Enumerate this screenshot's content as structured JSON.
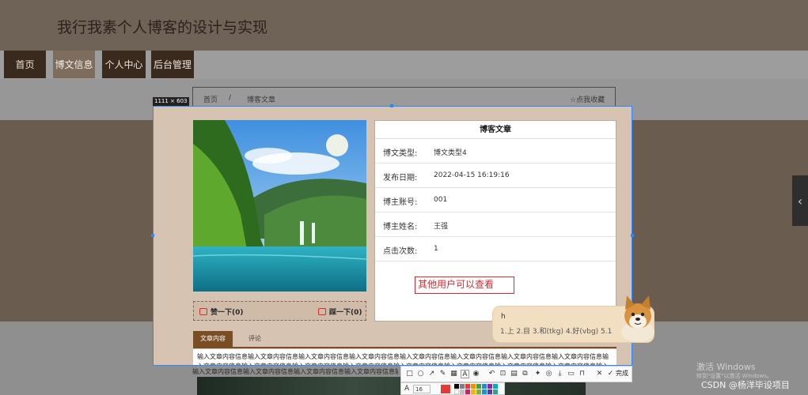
{
  "site": {
    "title": "我行我素个人博客的设计与实现"
  },
  "nav": [
    {
      "label": "首页",
      "active": false
    },
    {
      "label": "博文信息",
      "active": true
    },
    {
      "label": "个人中心",
      "active": false
    },
    {
      "label": "后台管理",
      "active": false
    }
  ],
  "breadcrumb": {
    "home": "首页",
    "separator": "/",
    "current": "博客文章",
    "favorite": "☆点我收藏"
  },
  "capture": {
    "dimensions_label": "1111 × 603"
  },
  "detail": {
    "title": "博客文章",
    "rows": [
      {
        "label": "博文类型:",
        "value": "博文类型4"
      },
      {
        "label": "发布日期:",
        "value": "2022-04-15 16:19:16"
      },
      {
        "label": "博主账号:",
        "value": "001"
      },
      {
        "label": "博主姓名:",
        "value": "王强"
      },
      {
        "label": "点击次数:",
        "value": "1"
      }
    ],
    "annotation": "其他用户可以查看"
  },
  "votes": {
    "up": "赞一下(0)",
    "down": "踩一下(0)"
  },
  "tabs": [
    {
      "label": "文章内容",
      "active": true
    },
    {
      "label": "评论",
      "active": false
    }
  ],
  "article": {
    "text": "输入文章内容信息输入文章内容信息输入文章内容信息输入文章内容信息输入文章内容信息输入文章内容信息输入文章内容信息输入文章内容信息输入文章内容信息输入文章内容信息输入文章内容信息输入文章内容信息输入文章内容信息输入文章内容信息输入文章内容信息输入文章内容信息输入文章内容信息输入文章内容信息输入文章内容信息输入文章内容信息"
  },
  "toolbar": {
    "done_label": "完成",
    "font_size": "16",
    "tools": [
      "rect-icon",
      "ellipse-icon",
      "arrow-icon",
      "pen-icon",
      "mosaic-icon",
      "text-icon",
      "marker-icon",
      "undo-icon",
      "pin-icon",
      "ocr-icon",
      "screenshot-icon",
      "translate-icon",
      "save-icon",
      "copy-icon",
      "cancel-icon"
    ],
    "swatches": [
      "#e53935",
      "#000000",
      "#7f7f7f",
      "#1e88e5",
      "#43a047",
      "#8e24aa",
      "#00acc1",
      "#ffffff",
      "#ffb300",
      "#d81b60"
    ]
  },
  "ime": {
    "input": "h",
    "candidates": "1.上  2.目  3.和(tkg)  4.好(vbg)  5.1"
  },
  "windows_watermark": {
    "line1": "激活 Windows",
    "line2": "转到\"设置\"以激活 Windows。"
  },
  "csdn": "CSDN @杨洋毕设项目"
}
